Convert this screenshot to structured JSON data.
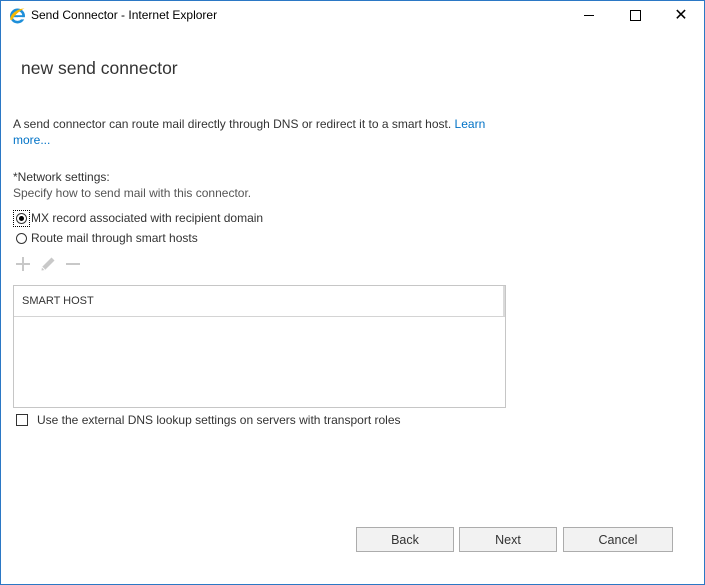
{
  "window": {
    "title": "Send Connector - Internet Explorer",
    "icon": "internet-explorer-icon",
    "controls": {
      "minimize": "minimize-icon",
      "maximize": "maximize-icon",
      "close_glyph": "✕"
    }
  },
  "page": {
    "title": "new send connector",
    "intro_text": "A send connector can route mail directly through DNS or redirect it to a smart host. ",
    "learn_more_link": "Learn more...",
    "network_settings_label": "*Network settings:",
    "network_settings_description": "Specify how to send mail with this connector."
  },
  "routing_options": [
    {
      "label": "MX record associated with recipient domain",
      "checked": true
    },
    {
      "label": "Route mail through smart hosts",
      "checked": false
    }
  ],
  "smart_host_toolbar": {
    "add_icon": "plus-icon",
    "edit_icon": "pencil-icon",
    "remove_icon": "minus-icon",
    "enabled": false
  },
  "smart_host_table": {
    "column_header": "SMART HOST",
    "rows": []
  },
  "external_dns_checkbox": {
    "label": "Use the external DNS lookup settings on servers with transport roles",
    "checked": false
  },
  "buttons": {
    "back": "Back",
    "next": "Next",
    "cancel": "Cancel"
  },
  "colors": {
    "link": "#0072c6",
    "frame_border": "#2b78c5",
    "disabled_icon": "#c8c8c8"
  }
}
